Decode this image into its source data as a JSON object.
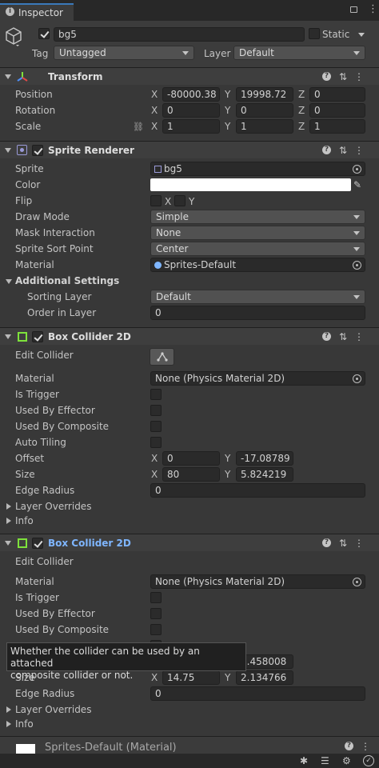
{
  "tab": {
    "title": "Inspector"
  },
  "object": {
    "name": "bg5",
    "static_label": "Static",
    "tag_label": "Tag",
    "tag_value": "Untagged",
    "layer_label": "Layer",
    "layer_value": "Default"
  },
  "transform": {
    "title": "Transform",
    "position": {
      "label": "Position",
      "x": "-80000.38",
      "y": "19998.72",
      "z": "0"
    },
    "rotation": {
      "label": "Rotation",
      "x": "0",
      "y": "0",
      "z": "0"
    },
    "scale": {
      "label": "Scale",
      "x": "1",
      "y": "1",
      "z": "1"
    }
  },
  "sprite_renderer": {
    "title": "Sprite Renderer",
    "sprite_label": "Sprite",
    "sprite_value": "bg5",
    "color_label": "Color",
    "color_value": "#ffffff",
    "flip_label": "Flip",
    "flip_x": "X",
    "flip_y": "Y",
    "draw_mode_label": "Draw Mode",
    "draw_mode_value": "Simple",
    "mask_label": "Mask Interaction",
    "mask_value": "None",
    "sort_point_label": "Sprite Sort Point",
    "sort_point_value": "Center",
    "material_label": "Material",
    "material_value": "Sprites-Default",
    "additional_label": "Additional Settings",
    "sorting_layer_label": "Sorting Layer",
    "sorting_layer_value": "Default",
    "order_label": "Order in Layer",
    "order_value": "0"
  },
  "collider1": {
    "title": "Box Collider 2D",
    "edit_label": "Edit Collider",
    "material_label": "Material",
    "material_value": "None (Physics Material 2D)",
    "trigger_label": "Is Trigger",
    "effector_label": "Used By Effector",
    "composite_label": "Used By Composite",
    "tiling_label": "Auto Tiling",
    "offset_label": "Offset",
    "offset_x": "0",
    "offset_y": "-17.08789",
    "size_label": "Size",
    "size_x": "80",
    "size_y": "5.824219",
    "radius_label": "Edge Radius",
    "radius_value": "0",
    "overrides_label": "Layer Overrides",
    "info_label": "Info"
  },
  "collider2": {
    "title": "Box Collider 2D",
    "edit_label": "Edit Collider",
    "material_label": "Material",
    "material_value": "None (Physics Material 2D)",
    "trigger_label": "Is Trigger",
    "effector_label": "Used By Effector",
    "composite_label": "Used By Composite",
    "offset_y_partial": "5.458008",
    "size_label": "Size",
    "size_x": "14.75",
    "size_y": "2.134766",
    "radius_label": "Edge Radius",
    "radius_value": "0",
    "overrides_label": "Layer Overrides",
    "info_label": "Info"
  },
  "tooltip": {
    "line1": "Whether the collider can be used by an attached",
    "line2": "composite collider or not."
  },
  "material_footer": {
    "title": "Sprites-Default (Material)"
  },
  "axes": {
    "x": "X",
    "y": "Y",
    "z": "Z"
  },
  "colors": {
    "accent_green": "#7ee23b",
    "highlight_blue": "#7fb6ff",
    "tab_underline": "#3a79bb"
  }
}
